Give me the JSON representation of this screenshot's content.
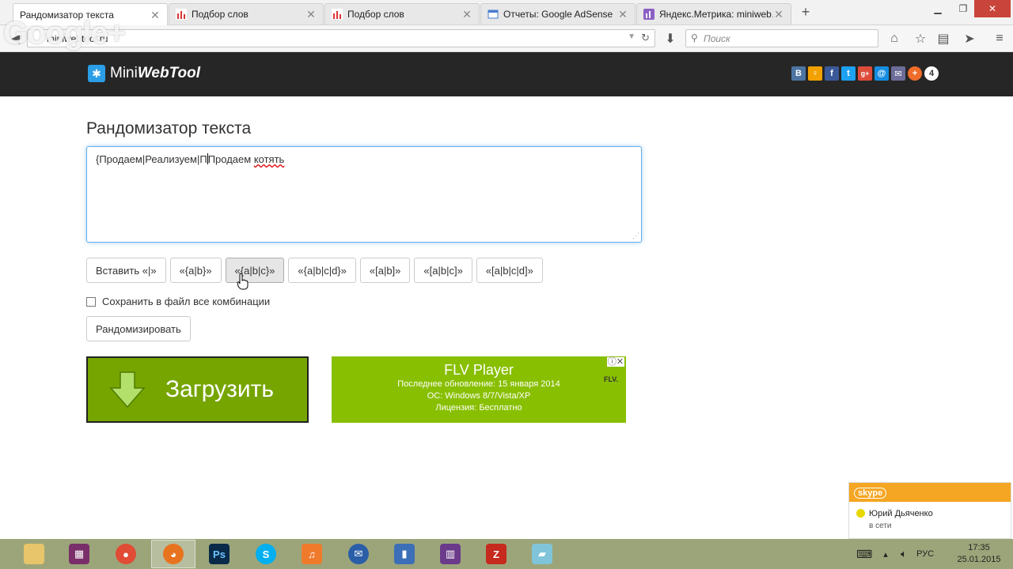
{
  "browser": {
    "tabs": [
      {
        "label": "Рандомизатор текста",
        "active": true
      },
      {
        "label": "Подбор слов",
        "active": false
      },
      {
        "label": "Подбор слов",
        "active": false
      },
      {
        "label": "Отчеты: Google AdSense",
        "active": false
      },
      {
        "label": "Яндекс.Метрика: miniweb…",
        "active": false
      }
    ],
    "url": "miniwebtool.ru",
    "search_placeholder": "Поиск",
    "gplus_overlay": "Google+"
  },
  "site": {
    "logo_part1": "Mini",
    "logo_part2": "WebTool",
    "social_icons": [
      "vk",
      "odnoklassniki",
      "facebook",
      "twitter",
      "google-plus",
      "mail-ru",
      "email",
      "more"
    ],
    "share_count": "4"
  },
  "page": {
    "title": "Рандомизатор текста",
    "textarea": {
      "before_caret": "{Продаем|Реализуем|П",
      "after_caret": "Продаем ",
      "misspelled": "котять"
    },
    "buttons": [
      "Вставить «|»",
      "«{a|b}»",
      "«{a|b|c}»",
      "«{a|b|c|d}»",
      "«[a|b]»",
      "«[a|b|c]»",
      "«[a|b|c|d]»"
    ],
    "save_checkbox_label": "Сохранить в файл все комбинации",
    "randomize_button": "Рандомизировать",
    "download_button": "Загрузить",
    "ad": {
      "title": "FLV Player",
      "line1": "Последнее обновление: 15 января 2014",
      "line2": "ОС: Windows 8/7/Vista/XP",
      "line3": "Лицензия: Бесплатно",
      "logo": "FLV."
    }
  },
  "skype": {
    "brand": "skype",
    "contact": "Юрий  Дьяченко",
    "status": "в сети"
  },
  "taskbar": {
    "language": "РУС",
    "time": "17:35",
    "date": "25.01.2015"
  },
  "colors": {
    "header_bg": "#262626",
    "download_green": "#76a500",
    "ad_green": "#88bf00",
    "focus_blue": "#66afe9",
    "skype_orange": "#f5a623",
    "taskbar": "#9ca57a"
  }
}
